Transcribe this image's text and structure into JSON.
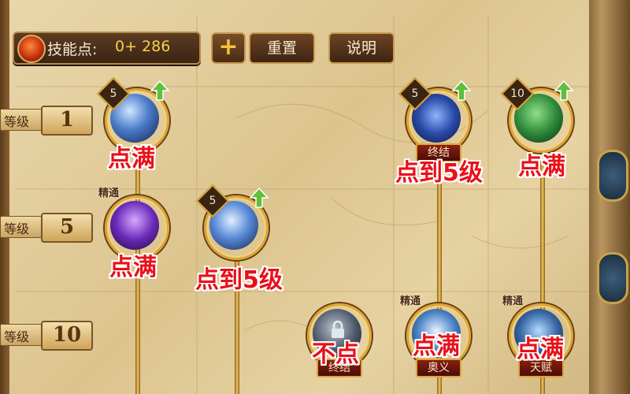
{
  "header": {
    "skill_points_label": "技能点:",
    "skill_points_value": "0+ 286",
    "plus_label": "+",
    "reset_label": "重置",
    "help_label": "说明"
  },
  "levels": [
    {
      "prefix": "等级",
      "value": "1"
    },
    {
      "prefix": "等级",
      "value": "5"
    },
    {
      "prefix": "等级",
      "value": "10"
    }
  ],
  "skills": {
    "r1c1": {
      "level": "5",
      "upgradable": true,
      "annotation": "点满"
    },
    "r1c4": {
      "level": "5",
      "upgradable": true,
      "name": "终结",
      "annotation": "点到5级"
    },
    "r1c5": {
      "level": "10",
      "upgradable": true,
      "annotation": "点满"
    },
    "r2c1": {
      "badge": "精通",
      "annotation": "点满"
    },
    "r2c2": {
      "level": "5",
      "upgradable": true,
      "annotation": "点到5级"
    },
    "r3c3": {
      "name": "终结",
      "locked": true,
      "annotation": "不点"
    },
    "r3c4": {
      "badge": "精通",
      "name": "奥义",
      "annotation": "点满"
    },
    "r3c5": {
      "badge": "精通",
      "name": "天赋",
      "annotation": "点满"
    }
  },
  "icons": [
    "skill-point-coin-icon",
    "plus-icon",
    "upgrade-arrow-icon",
    "lock-icon"
  ],
  "colors": {
    "annotation": "#e8101a",
    "gold": "#d9a53c",
    "upgrade": "#5fbf3a"
  }
}
